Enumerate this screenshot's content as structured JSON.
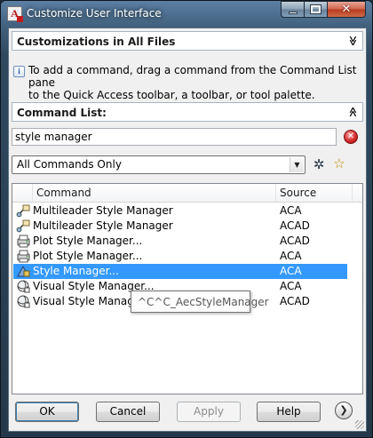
{
  "window": {
    "title": "Customize User Interface",
    "app_icon_letter": "A"
  },
  "customizations_panel": {
    "header": "Customizations in All Files",
    "collapse_glyph": "≫"
  },
  "info": {
    "line1": "To add a command, drag a command from the Command List pane",
    "line2": "to the Quick Access toolbar, a toolbar, or tool palette."
  },
  "command_list_panel": {
    "header": "Command List:",
    "collapse_glyph": "≪"
  },
  "search": {
    "value": "style manager",
    "clear_glyph": "✕"
  },
  "filter": {
    "selected": "All Commands Only",
    "arrow_glyph": "▼"
  },
  "toolbar_icons": {
    "find_glyph": "✲",
    "new_glyph": "☆"
  },
  "table": {
    "columns": {
      "command": "Command",
      "source": "Source"
    },
    "rows": [
      {
        "command": "Multileader Style Manager",
        "source": "ACA",
        "icon": "multileader-style-icon"
      },
      {
        "command": "Multileader Style Manager",
        "source": "ACAD",
        "icon": "multileader-style-icon"
      },
      {
        "command": "Plot Style Manager...",
        "source": "ACAD",
        "icon": "plot-style-icon"
      },
      {
        "command": "Plot Style Manager...",
        "source": "ACA",
        "icon": "plot-style-icon"
      },
      {
        "command": "Style Manager...",
        "source": "ACA",
        "icon": "style-manager-icon",
        "selected": true
      },
      {
        "command": "Visual Style Manager...",
        "source": "ACA",
        "icon": "visual-style-icon"
      },
      {
        "command": "Visual Style Manager...",
        "source": "ACAD",
        "icon": "visual-style-icon"
      }
    ]
  },
  "tooltip": {
    "text": "^C^C_AecStyleManager"
  },
  "buttons": {
    "ok": "OK",
    "cancel": "Cancel",
    "apply": "Apply",
    "help": "Help",
    "expand_glyph": "❯"
  },
  "colors": {
    "selection": "#3399ff",
    "frame": "#42627f",
    "close_button": "#c8452a"
  }
}
